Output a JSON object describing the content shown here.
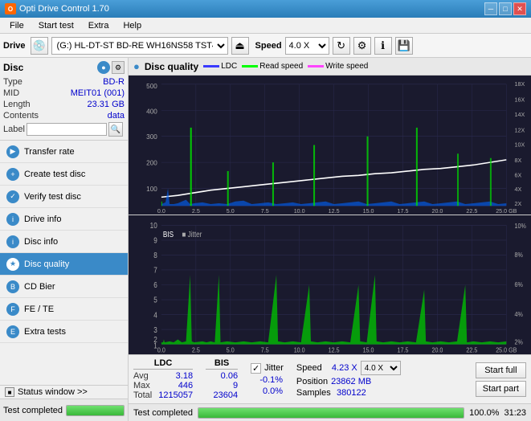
{
  "titleBar": {
    "title": "Opti Drive Control 1.70",
    "minimizeLabel": "─",
    "maximizeLabel": "□",
    "closeLabel": "✕"
  },
  "menuBar": {
    "items": [
      "File",
      "Start test",
      "Extra",
      "Help"
    ]
  },
  "toolbar": {
    "driveLabel": "Drive",
    "driveValue": "(G:)  HL-DT-ST BD-RE  WH16NS58 TST4",
    "speedLabel": "Speed",
    "speedValue": "4.0 X"
  },
  "disc": {
    "title": "Disc",
    "typeLabel": "Type",
    "typeValue": "BD-R",
    "midLabel": "MID",
    "midValue": "MEIT01 (001)",
    "lengthLabel": "Length",
    "lengthValue": "23.31 GB",
    "contentsLabel": "Contents",
    "contentsValue": "data",
    "labelLabel": "Label",
    "labelValue": ""
  },
  "navItems": [
    {
      "id": "transfer-rate",
      "label": "Transfer rate",
      "active": false
    },
    {
      "id": "create-test-disc",
      "label": "Create test disc",
      "active": false
    },
    {
      "id": "verify-test-disc",
      "label": "Verify test disc",
      "active": false
    },
    {
      "id": "drive-info",
      "label": "Drive info",
      "active": false
    },
    {
      "id": "disc-info",
      "label": "Disc info",
      "active": false
    },
    {
      "id": "disc-quality",
      "label": "Disc quality",
      "active": true
    },
    {
      "id": "cd-bier",
      "label": "CD Bier",
      "active": false
    },
    {
      "id": "fe-te",
      "label": "FE / TE",
      "active": false
    },
    {
      "id": "extra-tests",
      "label": "Extra tests",
      "active": false
    }
  ],
  "statusWindow": {
    "label": "Status window >>"
  },
  "chartHeader": {
    "title": "Disc quality",
    "legendLDC": "LDC",
    "legendRead": "Read speed",
    "legendWrite": "Write speed"
  },
  "chart1": {
    "yMax": 500,
    "yLabels": [
      "500",
      "400",
      "300",
      "200",
      "100",
      "0"
    ],
    "yRight": [
      "18X",
      "16X",
      "14X",
      "12X",
      "10X",
      "8X",
      "6X",
      "4X",
      "2X"
    ],
    "xLabels": [
      "0.0",
      "2.5",
      "5.0",
      "7.5",
      "10.0",
      "12.5",
      "15.0",
      "17.5",
      "20.0",
      "22.5",
      "25.0 GB"
    ],
    "bisLabel": "BIS",
    "jitterLabel": "Jitter"
  },
  "chart2": {
    "yLabels": [
      "10",
      "9",
      "8",
      "7",
      "6",
      "5",
      "4",
      "3",
      "2",
      "1"
    ],
    "yRight": [
      "10%",
      "8%",
      "6%",
      "4%",
      "2%"
    ],
    "xLabels": [
      "0.0",
      "2.5",
      "5.0",
      "7.5",
      "10.0",
      "12.5",
      "15.0",
      "17.5",
      "20.0",
      "22.5",
      "25.0 GB"
    ]
  },
  "stats": {
    "ldcHeader": "LDC",
    "bisHeader": "BIS",
    "avgLabel": "Avg",
    "maxLabel": "Max",
    "totalLabel": "Total",
    "ldcAvg": "3.18",
    "ldcMax": "446",
    "ldcTotal": "1215057",
    "bisAvg": "0.06",
    "bisMax": "9",
    "bisTotal": "23604",
    "jitterLabel": "Jitter",
    "jitterAvg": "-0.1%",
    "jitterMax": "0.0%",
    "jitterTotal": "",
    "speedLabel": "Speed",
    "speedValue": "4.23 X",
    "speedSelect": "4.0 X",
    "positionLabel": "Position",
    "positionValue": "23862 MB",
    "samplesLabel": "Samples",
    "samplesValue": "380122",
    "startFullLabel": "Start full",
    "startPartLabel": "Start part"
  },
  "statusBar": {
    "statusText": "Test completed",
    "progressPercent": 100,
    "progressLabel": "100.0%",
    "timeLabel": "31:23"
  }
}
